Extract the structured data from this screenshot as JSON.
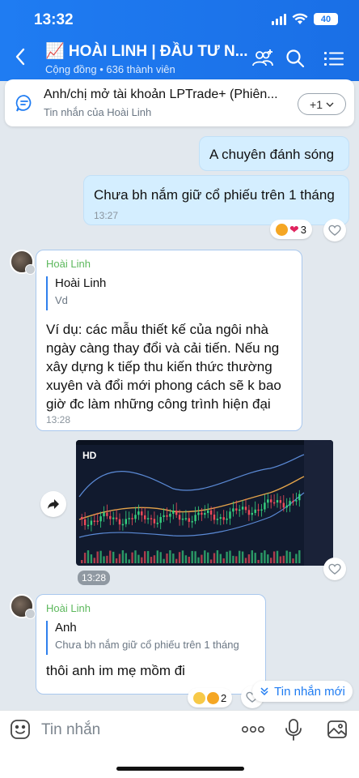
{
  "status": {
    "time": "13:32",
    "battery": "40"
  },
  "header": {
    "title": "📈 HOÀI LINH | ĐẦU TƯ N...",
    "subtitle": "Cộng đồng • 636 thành viên"
  },
  "pinned": {
    "title": "Anh/chị mở tài khoản LPTrade+ (Phiên...",
    "sub": "Tin nhắn của Hoài Linh",
    "more_label": "+1"
  },
  "messages": {
    "out1": {
      "text": "A chuyên đánh sóng"
    },
    "out2": {
      "text": "Chưa bh nắm giữ cổ phiếu trên 1 tháng",
      "time": "13:27",
      "reaction_count": "3"
    },
    "in1": {
      "sender": "Hoài Linh",
      "quote_name": "Hoài Linh",
      "quote_text": "Vd",
      "text": "Ví dụ: các mẫu thiết kế của ngôi nhà ngày càng thay đổi và cải tiến. Nếu ng xây dựng k tiếp thu kiến thức thường xuyên và đổi mới phong cách sẽ k bao giờ đc làm những công trình hiện đại",
      "time": "13:28"
    },
    "image": {
      "hd_label": "HD",
      "time": "13:28"
    },
    "in2": {
      "sender": "Hoài Linh",
      "quote_name": "Anh",
      "quote_text": "Chưa bh nắm giữ cổ phiếu trên 1 tháng",
      "text": "thôi anh im mẹ mồm đi",
      "reaction_count": "2"
    }
  },
  "new_messages_label": "Tin nhắn mới",
  "input": {
    "placeholder": "Tin nhắn"
  },
  "colors": {
    "brand": "#1f7cf2",
    "outgoing": "#d4eeff",
    "sender": "#5cb85c"
  }
}
